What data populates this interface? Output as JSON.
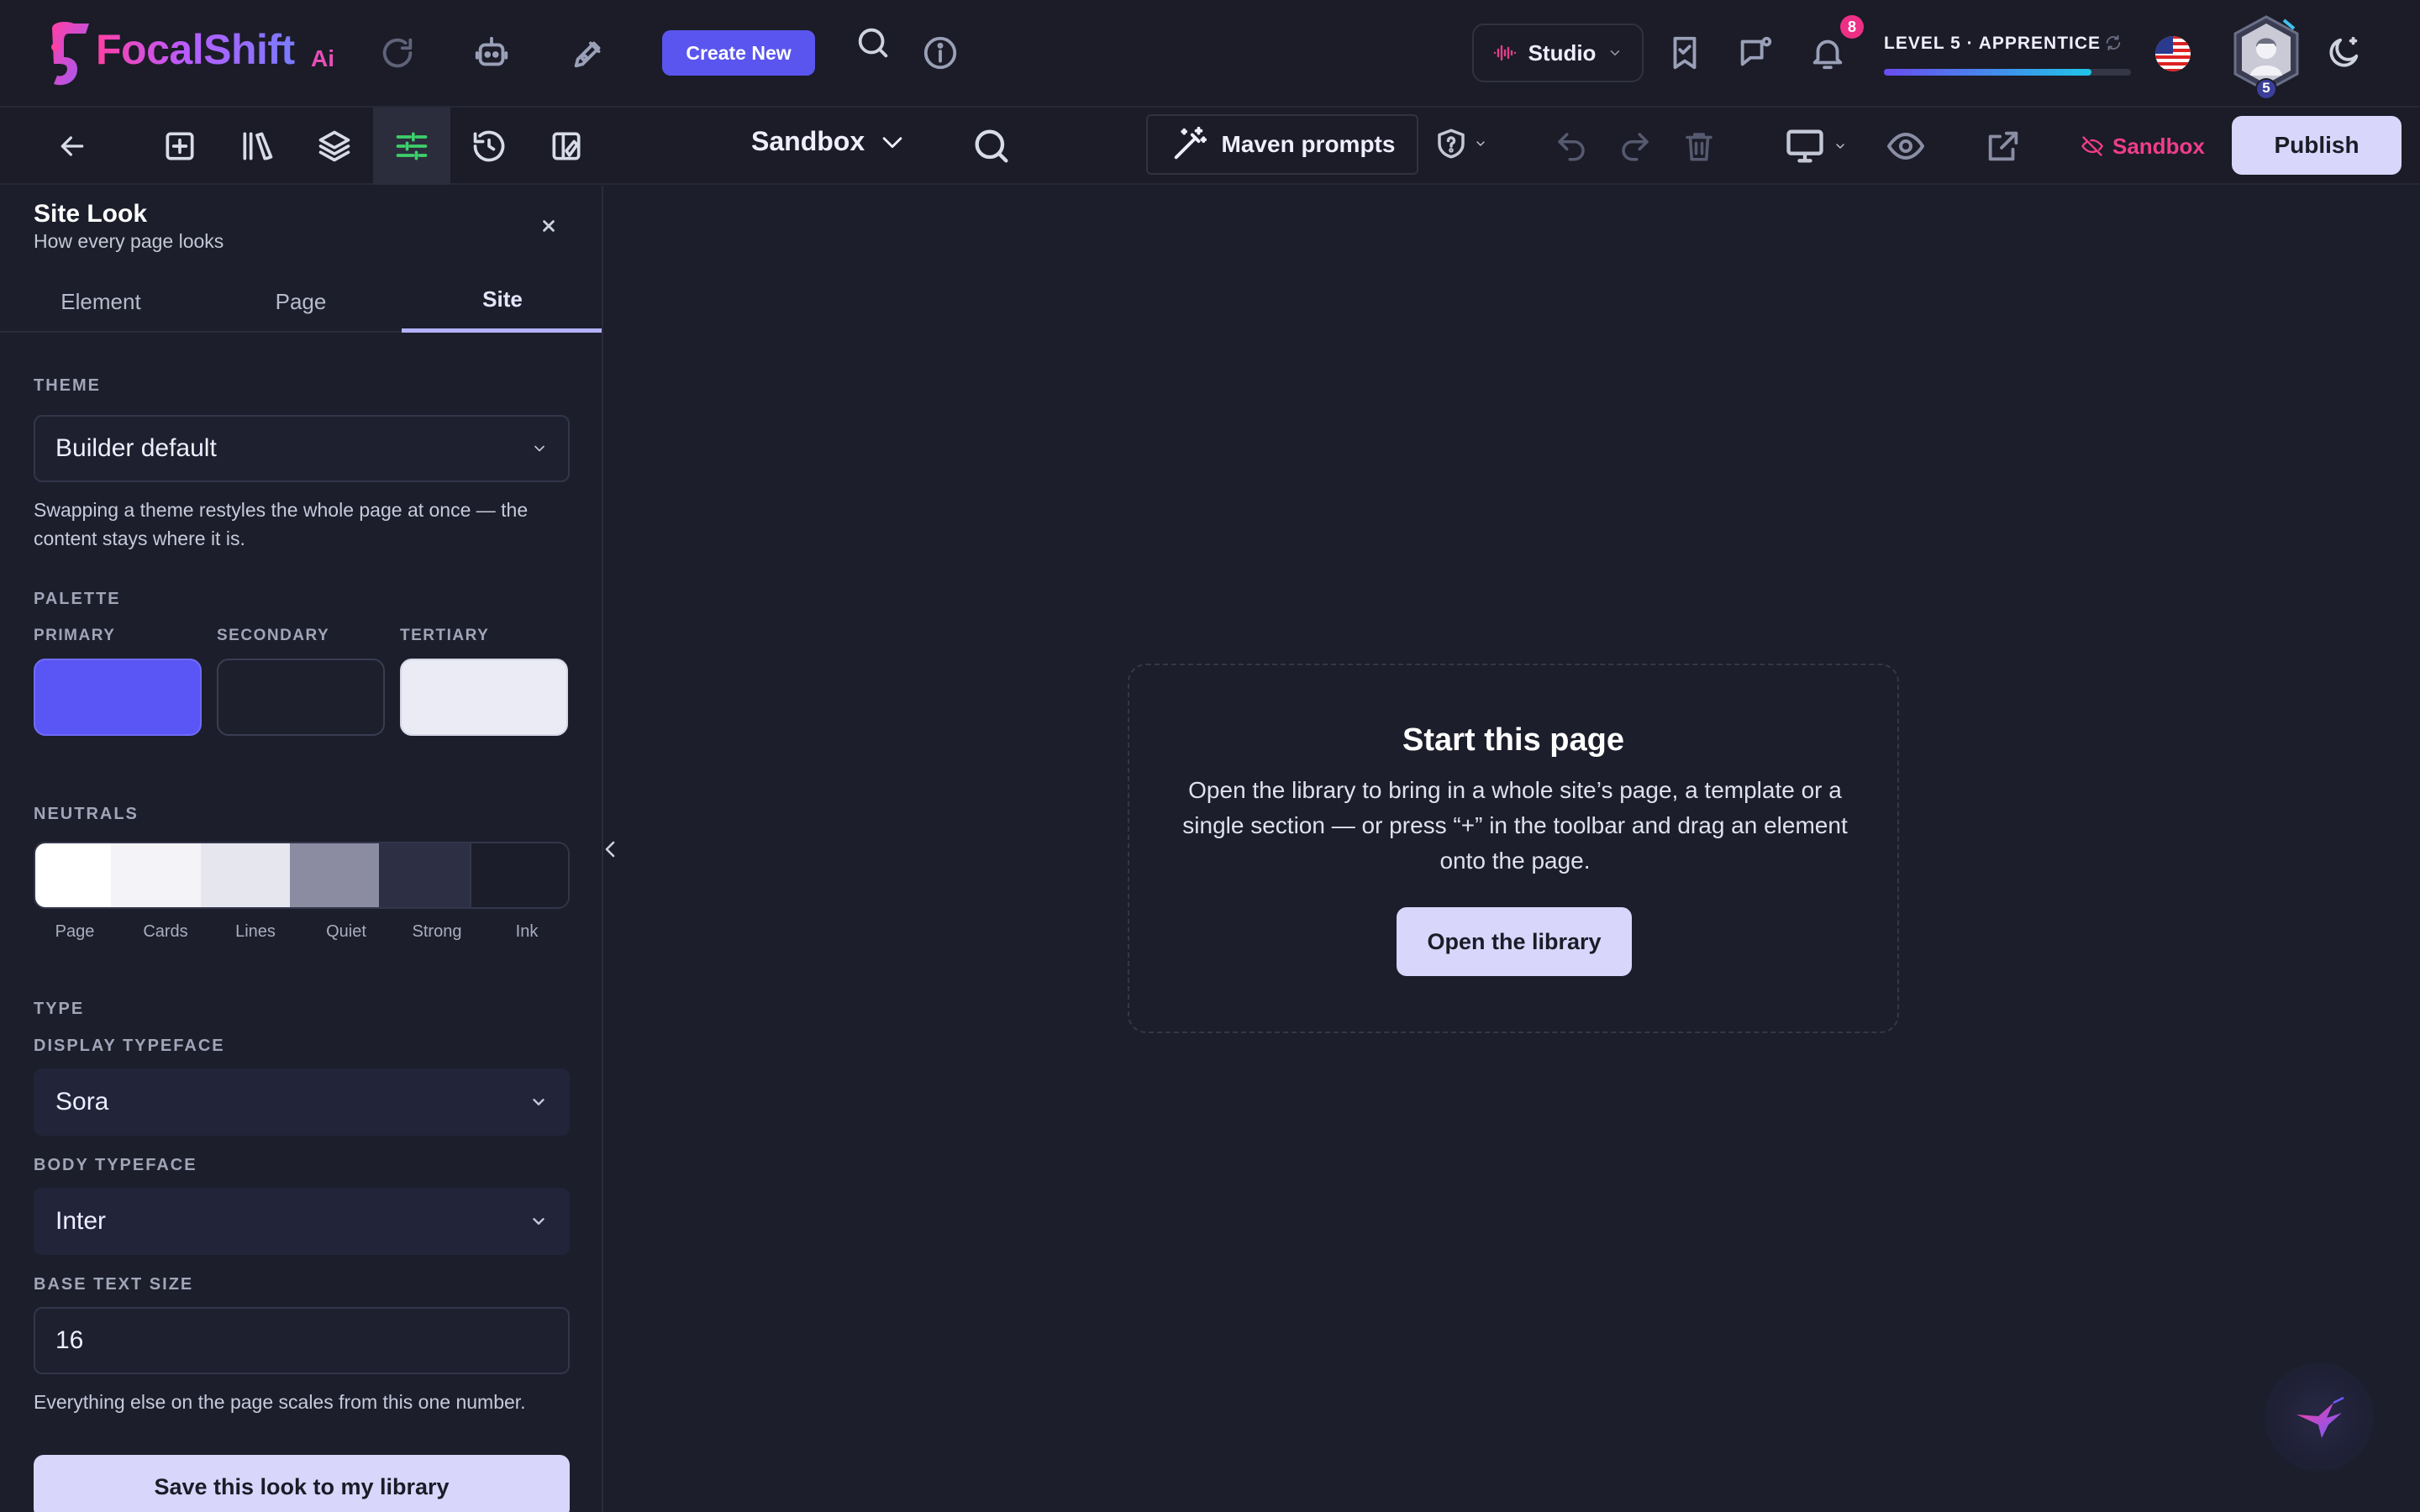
{
  "brand": {
    "name": "FocalShift",
    "suffix": "Ai"
  },
  "topbar": {
    "create_label": "Create New",
    "studio_label": "Studio",
    "notifications_count": "8",
    "level_label": "LEVEL 5 · APPRENTICE",
    "xp_progress": 0.84,
    "avatar_level": "5"
  },
  "toolbar": {
    "page_selector": "Sandbox",
    "maven_label": "Maven prompts",
    "sandbox_tag": "Sandbox",
    "publish_label": "Publish"
  },
  "panel": {
    "title": "Site Look",
    "subtitle": "How every page looks",
    "tabs": [
      {
        "label": "Element"
      },
      {
        "label": "Page"
      },
      {
        "label": "Site"
      }
    ],
    "active_tab": "Site",
    "theme": {
      "label": "THEME",
      "value": "Builder default",
      "help": "Swapping a theme restyles the whole page at once — the content stays where it is."
    },
    "palette": {
      "label": "PALETTE",
      "swatches": [
        {
          "label": "PRIMARY",
          "color": "#5a55f5"
        },
        {
          "label": "SECONDARY",
          "color": "#1e1f2d"
        },
        {
          "label": "TERTIARY",
          "color": "#ebebf5"
        }
      ]
    },
    "neutrals": {
      "label": "NEUTRALS",
      "items": [
        {
          "label": "Page",
          "color": "#ffffff"
        },
        {
          "label": "Cards",
          "color": "#f3f3f8"
        },
        {
          "label": "Lines",
          "color": "#e6e6ef"
        },
        {
          "label": "Quiet",
          "color": "#8b8ba2"
        },
        {
          "label": "Strong",
          "color": "#2d2f45"
        },
        {
          "label": "Ink",
          "color": "#1c1d2a"
        }
      ]
    },
    "type": {
      "label": "TYPE",
      "display_label": "DISPLAY TYPEFACE",
      "display_value": "Sora",
      "body_label": "BODY TYPEFACE",
      "body_value": "Inter",
      "size_label": "BASE TEXT SIZE",
      "size_value": "16",
      "size_help": "Everything else on the page scales from this one number."
    },
    "save_label": "Save this look to my library"
  },
  "canvas": {
    "empty_title": "Start this page",
    "empty_desc": "Open the library to bring in a whole site’s page, a template or a single section — or press “+” in the toolbar and drag an element onto the page.",
    "empty_button": "Open the library"
  },
  "colors": {
    "accent": "#5a55ee",
    "publish": "#d8d6fb",
    "sandbox": "#f03d8b",
    "active_tool": "#3ecf6b"
  }
}
